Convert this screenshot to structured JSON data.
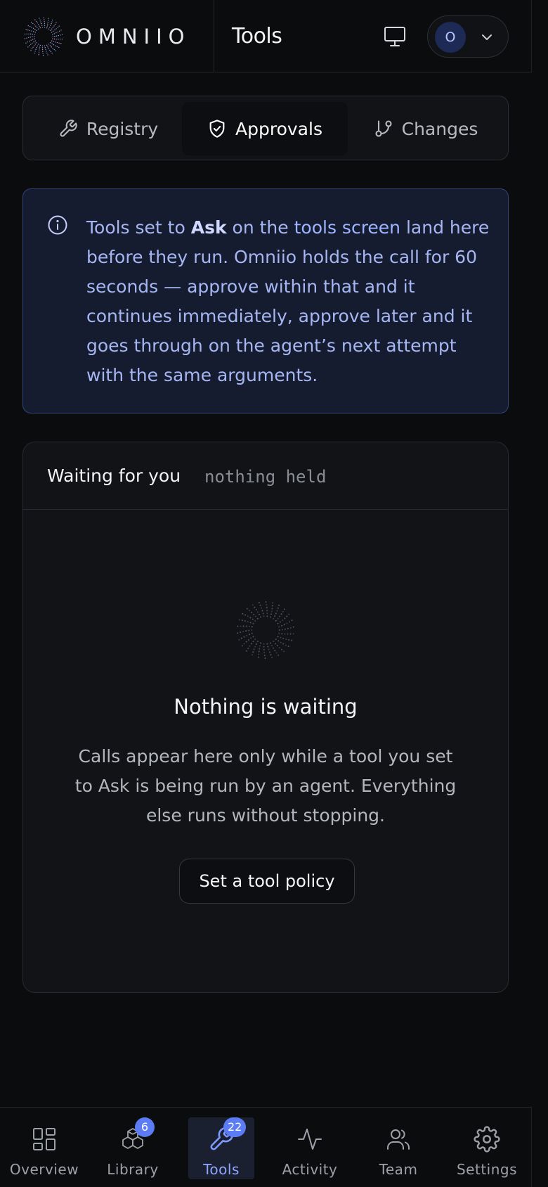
{
  "header": {
    "brand": "OMNIIO",
    "title": "Tools",
    "avatar_initial": "O",
    "icons": {
      "logo": "omniio-logo-icon",
      "monitor": "monitor-icon",
      "menu": "chevron-down-icon"
    }
  },
  "tabs": [
    {
      "label": "Registry",
      "icon": "wrench-icon",
      "active": false
    },
    {
      "label": "Approvals",
      "icon": "shield-check-icon",
      "active": true
    },
    {
      "label": "Changes",
      "icon": "git-branch-icon",
      "active": false
    }
  ],
  "info": {
    "icon": "info-icon",
    "pre": "Tools set to ",
    "bold": "Ask",
    "mid": " on the ",
    "link": "tools screen",
    "post": " land here before they run. Omniio holds the call for 60 seconds — approve within that and it continues immediately, approve later and it goes through on the agent’s next attempt with the same arguments."
  },
  "waiting": {
    "title": "Waiting for you",
    "status": "nothing held",
    "empty_title": "Nothing is waiting",
    "empty_description": "Calls appear here only while a tool you set to Ask is being run by an agent. Everything else runs without stopping.",
    "action_label": "Set a tool policy"
  },
  "bottom_nav": [
    {
      "label": "Overview",
      "icon": "grid-icon",
      "badge": null,
      "active": false
    },
    {
      "label": "Library",
      "icon": "boxes-icon",
      "badge": "6",
      "active": false
    },
    {
      "label": "Tools",
      "icon": "wrench-icon",
      "badge": "22",
      "active": true
    },
    {
      "label": "Activity",
      "icon": "activity-icon",
      "badge": null,
      "active": false
    },
    {
      "label": "Team",
      "icon": "users-icon",
      "badge": null,
      "active": false
    },
    {
      "label": "Settings",
      "icon": "gear-icon",
      "badge": null,
      "active": false
    }
  ],
  "colors": {
    "accent": "#5b7cf5",
    "info_bg": "#161c30",
    "info_text": "#a6b6f2",
    "background": "#0b0c0e"
  }
}
